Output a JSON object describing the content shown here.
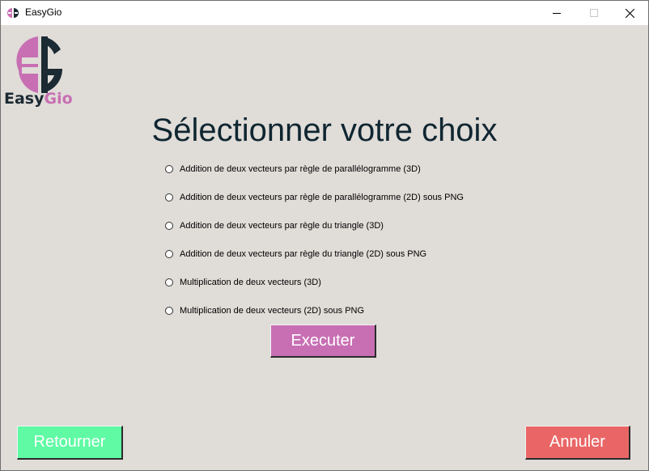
{
  "window": {
    "title": "EasyGio",
    "icon": "easygio-logo-icon",
    "controls": [
      "minimize-icon",
      "maximize-icon",
      "close-icon"
    ]
  },
  "logo": {
    "text_easy": "Easy",
    "text_gio": "Gio",
    "colors": {
      "pink": "#c86fb3",
      "dark": "#1b2a33"
    }
  },
  "heading": "Sélectionner votre choix",
  "options": [
    {
      "label": "Addition de deux vecteurs par règle de parallélogramme (3D)",
      "selected": false
    },
    {
      "label": "Addition de deux vecteurs par règle de parallélogramme (2D) sous PNG",
      "selected": false
    },
    {
      "label": "Addition de deux vecteurs par règle du triangle (3D)",
      "selected": false
    },
    {
      "label": "Addition de deux vecteurs par règle du triangle (2D) sous PNG",
      "selected": false
    },
    {
      "label": "Multiplication de deux vecteurs (3D)",
      "selected": false
    },
    {
      "label": "Multiplication de deux vecteurs (2D) sous PNG",
      "selected": false
    }
  ],
  "buttons": {
    "execute": "Executer",
    "back": "Retourner",
    "cancel": "Annuler"
  },
  "colors": {
    "background": "#e0dcd8",
    "execute": "#c86fb3",
    "back": "#5ffaa3",
    "cancel": "#ea6666",
    "heading": "#0f2631"
  }
}
